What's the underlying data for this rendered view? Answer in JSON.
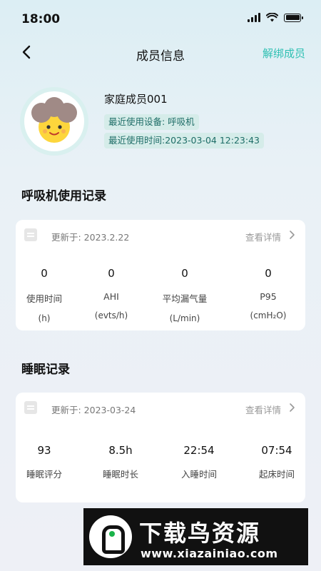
{
  "status_bar": {
    "time": "18:00"
  },
  "nav": {
    "title": "成员信息",
    "action": "解绑成员"
  },
  "profile": {
    "name": "家庭成员001",
    "device_tag": "最近使用设备: 呼吸机",
    "last_used_tag": "最近使用时间:2023-03-04 12:23:43"
  },
  "ventilator": {
    "section_title": "呼吸机使用记录",
    "updated": "更新于: 2023.2.22",
    "detail": "查看详情",
    "metrics": [
      {
        "value": "0",
        "label": "使用时间",
        "unit": "(h)"
      },
      {
        "value": "0",
        "label": "AHI",
        "unit": "(evts/h)"
      },
      {
        "value": "0",
        "label": "平均漏气量",
        "unit": "(L/min)"
      },
      {
        "value": "0",
        "label": "P95",
        "unit": "(cmH₂O)"
      }
    ]
  },
  "sleep": {
    "section_title": "睡眠记录",
    "updated": "更新于: 2023-03-24",
    "detail": "查看详情",
    "metrics": [
      {
        "value": "93",
        "label": "睡眠评分"
      },
      {
        "value": "8.5h",
        "label": "睡眠时长"
      },
      {
        "value": "22:54",
        "label": "入睡时间"
      },
      {
        "value": "07:54",
        "label": "起床时间"
      }
    ]
  },
  "watermark": {
    "title": "下载鸟资源",
    "url": "www.xiazainiao.com"
  },
  "colors": {
    "accent": "#2fc0b3",
    "tag_bg": "#d5ece9",
    "tag_text": "#1e6d67"
  },
  "icons": [
    "back-arrow-icon",
    "calendar-icon",
    "chevron-right-icon",
    "signal-icon",
    "wifi-icon",
    "battery-icon"
  ]
}
